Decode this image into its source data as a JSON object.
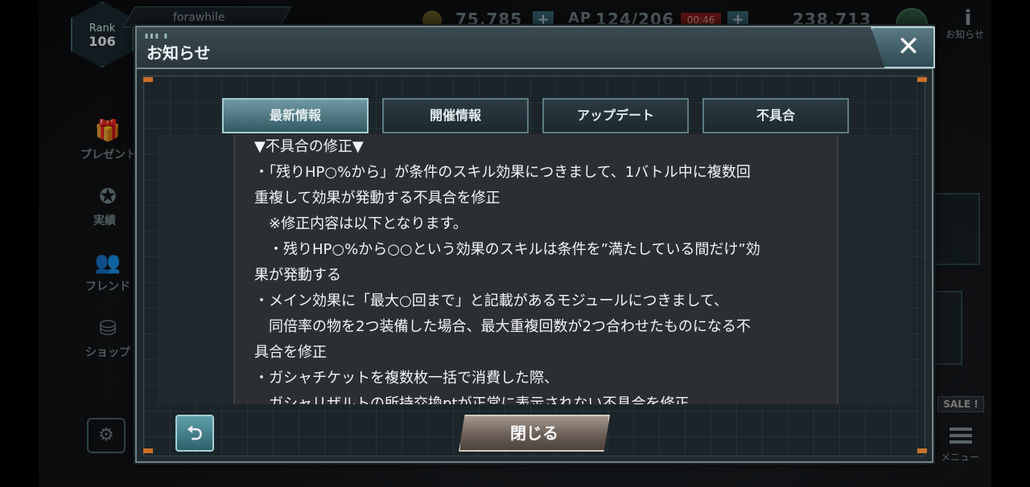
{
  "hud": {
    "rank_label": "Rank",
    "rank_value": "106",
    "player_name": "forawhile",
    "credits": "75,785",
    "ap_label": "AP",
    "ap_value": "124/206",
    "ap_timer": "00:46",
    "currency2": "238,713",
    "info_label": "お知らせ",
    "sidebar": [
      {
        "label": "プレゼント",
        "icon": "gift-icon"
      },
      {
        "label": "実績",
        "icon": "medal-icon"
      },
      {
        "label": "フレンド",
        "icon": "friends-icon"
      },
      {
        "label": "ショップ",
        "icon": "coins-icon"
      }
    ],
    "sale_label": "SALE !",
    "menu_label": "メニュー"
  },
  "dialog": {
    "title": "お知らせ",
    "close_icon": "close-icon",
    "tabs": [
      {
        "label": "最新情報",
        "active": true
      },
      {
        "label": "開催情報",
        "active": false
      },
      {
        "label": "アップデート",
        "active": false
      },
      {
        "label": "不具合",
        "active": false
      }
    ],
    "content_lines": [
      "▼不具合の修正▼",
      "・「残りHP○%から」が条件のスキル効果につきまして、1バトル中に複数回",
      "重複して効果が発動する不具合を修正",
      "　※修正内容は以下となります。",
      "　・残りHP○%から○○という効果のスキルは条件を”満たしている間だけ”効",
      "果が発動する",
      "・メイン効果に「最大○回まで」と記載があるモジュールにつきまして、",
      "　同倍率の物を2つ装備した場合、最大重複回数が2つ合わせたものになる不",
      "具合を修正",
      "・ガシャチケットを複数枚一括で消費した際、",
      "　ガシャリザルトの所持交換ptが正常に表示されない不具合を修正"
    ],
    "back_icon": "return-arrow-icon",
    "back_glyph": "⮌",
    "close_button_label": "閉じる"
  }
}
